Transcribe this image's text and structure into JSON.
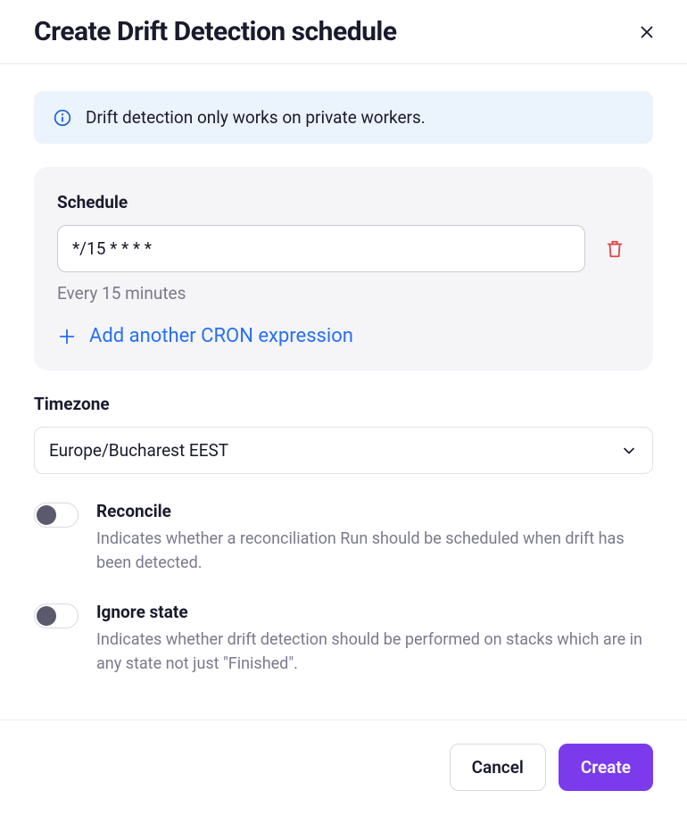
{
  "header": {
    "title": "Create Drift Detection schedule"
  },
  "callout": {
    "text": "Drift detection only works on private workers."
  },
  "schedule": {
    "label": "Schedule",
    "cron_value": "*/15 * * * *",
    "cron_hint": "Every 15 minutes",
    "add_label": "Add another CRON expression"
  },
  "timezone": {
    "label": "Timezone",
    "value": "Europe/Bucharest EEST"
  },
  "toggles": {
    "reconcile": {
      "title": "Reconcile",
      "desc": "Indicates whether a reconciliation Run should be scheduled when drift has been detected.",
      "on": false
    },
    "ignore_state": {
      "title": "Ignore state",
      "desc": "Indicates whether drift detection should be performed on stacks which are in any state not just \"Finished\".",
      "on": false
    }
  },
  "footer": {
    "cancel": "Cancel",
    "create": "Create"
  }
}
